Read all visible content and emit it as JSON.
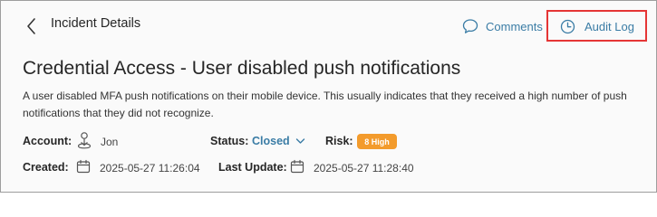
{
  "header": {
    "title": "Incident Details",
    "comments_label": "Comments",
    "audit_log_label": "Audit Log"
  },
  "incident": {
    "title": "Credential Access - User disabled push notifications",
    "description": "A user disabled MFA push notifications on their mobile device. This usually indicates that they received a high number of push notifications that they did not recognize."
  },
  "meta": {
    "account_label": "Account:",
    "account_value": "Jon",
    "status_label": "Status:",
    "status_value": "Closed",
    "risk_label": "Risk:",
    "risk_value": "8 High",
    "created_label": "Created:",
    "created_value": "2025-05-27 11:26:04",
    "last_update_label": "Last Update:",
    "last_update_value": "2025-05-27 11:28:40"
  },
  "icons": {
    "back": "chevron-left-icon",
    "comments": "speech-bubble-icon",
    "audit_log": "clock-icon",
    "account": "user-pin-icon",
    "status_dropdown": "chevron-down-icon",
    "calendar": "calendar-icon"
  },
  "colors": {
    "link": "#3a7ca5",
    "risk_high": "#f39b2c",
    "highlight": "#e53535"
  }
}
